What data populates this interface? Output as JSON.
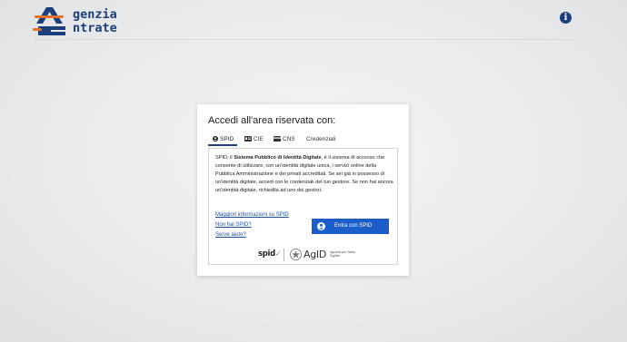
{
  "header": {
    "logo_line1": "genzia",
    "logo_line2": "ntrate",
    "info_icon": "i"
  },
  "login": {
    "title": "Accedi all'area riservata con:",
    "tabs": [
      {
        "label": "SPID",
        "icon": "user-icon",
        "active": true
      },
      {
        "label": "CIE",
        "icon": "id-card-icon",
        "active": false
      },
      {
        "label": "CNS",
        "icon": "card-icon",
        "active": false
      },
      {
        "label": "Credenziali",
        "icon": "",
        "active": false
      }
    ],
    "description_pre": "SPID, il ",
    "description_bold": "Sistema Pubblico di Identità Digitale",
    "description_post": ", è il sistema di accesso che consente di utilizzare, con un'identità digitale unica, i servizi online della Pubblica Amministrazione e dei privati accreditati. Se sei già in possesso di un'identità digitale, accedi con le credenziali del tuo gestore. Se non hai ancora un'identità digitale, richiedila ad uno dei gestori.",
    "links": [
      "Maggiori informazioni su SPID",
      "Non hai SPID?",
      "Serve aiuto?"
    ],
    "button_label": "Entra con SPID",
    "footer_logos": {
      "spid": "spid",
      "agid": "AgID",
      "agid_sub": "Agenzia per l'Italia Digitale"
    }
  },
  "colors": {
    "brand_blue": "#1c3f7c",
    "button_blue": "#1c5ec9",
    "logo_orange": "#e8722a"
  }
}
